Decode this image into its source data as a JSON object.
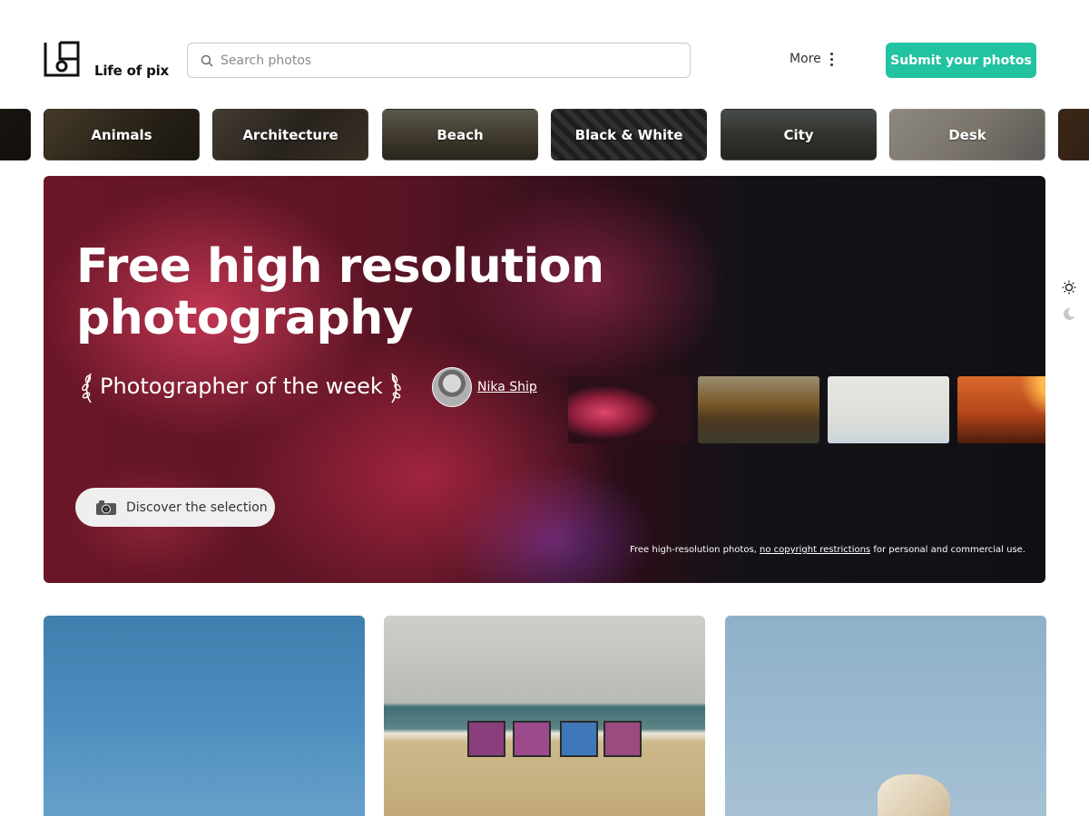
{
  "header": {
    "logo_text": "Life of pix",
    "search_placeholder": "Search photos",
    "more_label": "More",
    "submit_label": "Submit your photos"
  },
  "categories": [
    {
      "label": ""
    },
    {
      "label": "Animals"
    },
    {
      "label": "Architecture"
    },
    {
      "label": "Beach"
    },
    {
      "label": "Black & White"
    },
    {
      "label": "City"
    },
    {
      "label": "Desk"
    },
    {
      "label": ""
    }
  ],
  "hero": {
    "title": "Free high resolution photography",
    "photographer_of_week": "Photographer of the week",
    "photographer_name": "Nika Ship",
    "discover_label": "Discover the selection",
    "footer_prefix": "Free high-resolution photos, ",
    "footer_link": "no copyright restrictions",
    "footer_suffix": " for personal and commercial use."
  },
  "colors": {
    "accent": "#21c3a0"
  },
  "icons": [
    "search-icon",
    "kebab-icon",
    "laurel-icon",
    "camera-icon",
    "sun-icon",
    "moon-icon"
  ]
}
